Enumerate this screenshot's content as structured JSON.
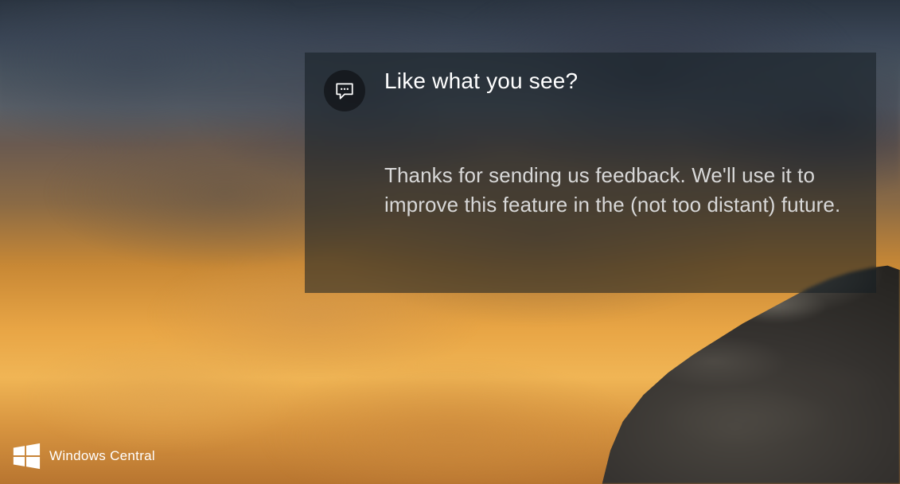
{
  "notification": {
    "title": "Like what you see?",
    "body": "Thanks for sending us feedback. We'll use it to improve this feature in the (not too distant) future."
  },
  "watermark": {
    "text": "Windows Central"
  }
}
